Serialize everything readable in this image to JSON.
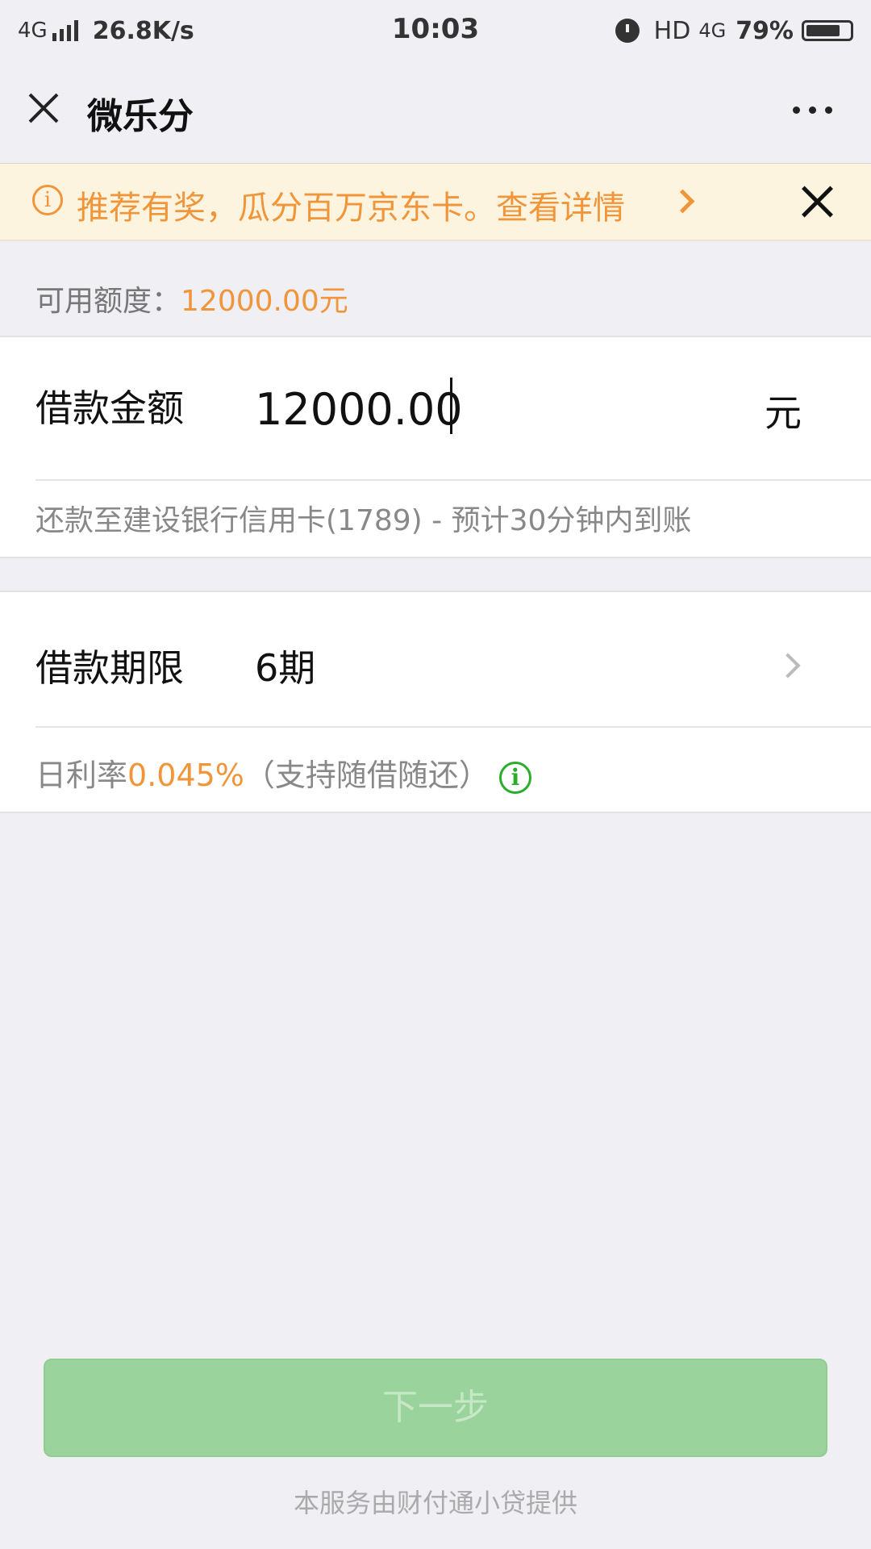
{
  "status_bar": {
    "network": "4G",
    "speed": "26.8K/s",
    "time": "10:03",
    "hd": "HD",
    "data_type": "4G",
    "battery": "79%",
    "battery_level": 0.79,
    "icons": [
      "signal-icon",
      "alarm-icon",
      "battery-icon"
    ]
  },
  "title_bar": {
    "title": "微乐分",
    "close_icon": "close-icon",
    "more_icon": "more-icon"
  },
  "promo": {
    "text": "推荐有奖，瓜分百万京东卡。查看详情",
    "info_symbol": "i",
    "accent": "#f0953a",
    "background": "#fcf4de"
  },
  "available": {
    "label": "可用额度：",
    "value": "12000.00元"
  },
  "amount": {
    "label": "借款金额",
    "value": "12000.00",
    "unit": "元",
    "note": "还款至建设银行信用卡(1789) - 预计30分钟内到账"
  },
  "term": {
    "label": "借款期限",
    "value": "6期",
    "rate_prefix": "日利率",
    "rate_value": "0.045%",
    "rate_suffix": "（支持随借随还）",
    "info_symbol": "i",
    "info_color": "#2aae2a"
  },
  "actions": {
    "next_label": "下一步",
    "next_color": "#9ad39b"
  },
  "footer": {
    "text": "本服务由财付通小贷提供"
  }
}
